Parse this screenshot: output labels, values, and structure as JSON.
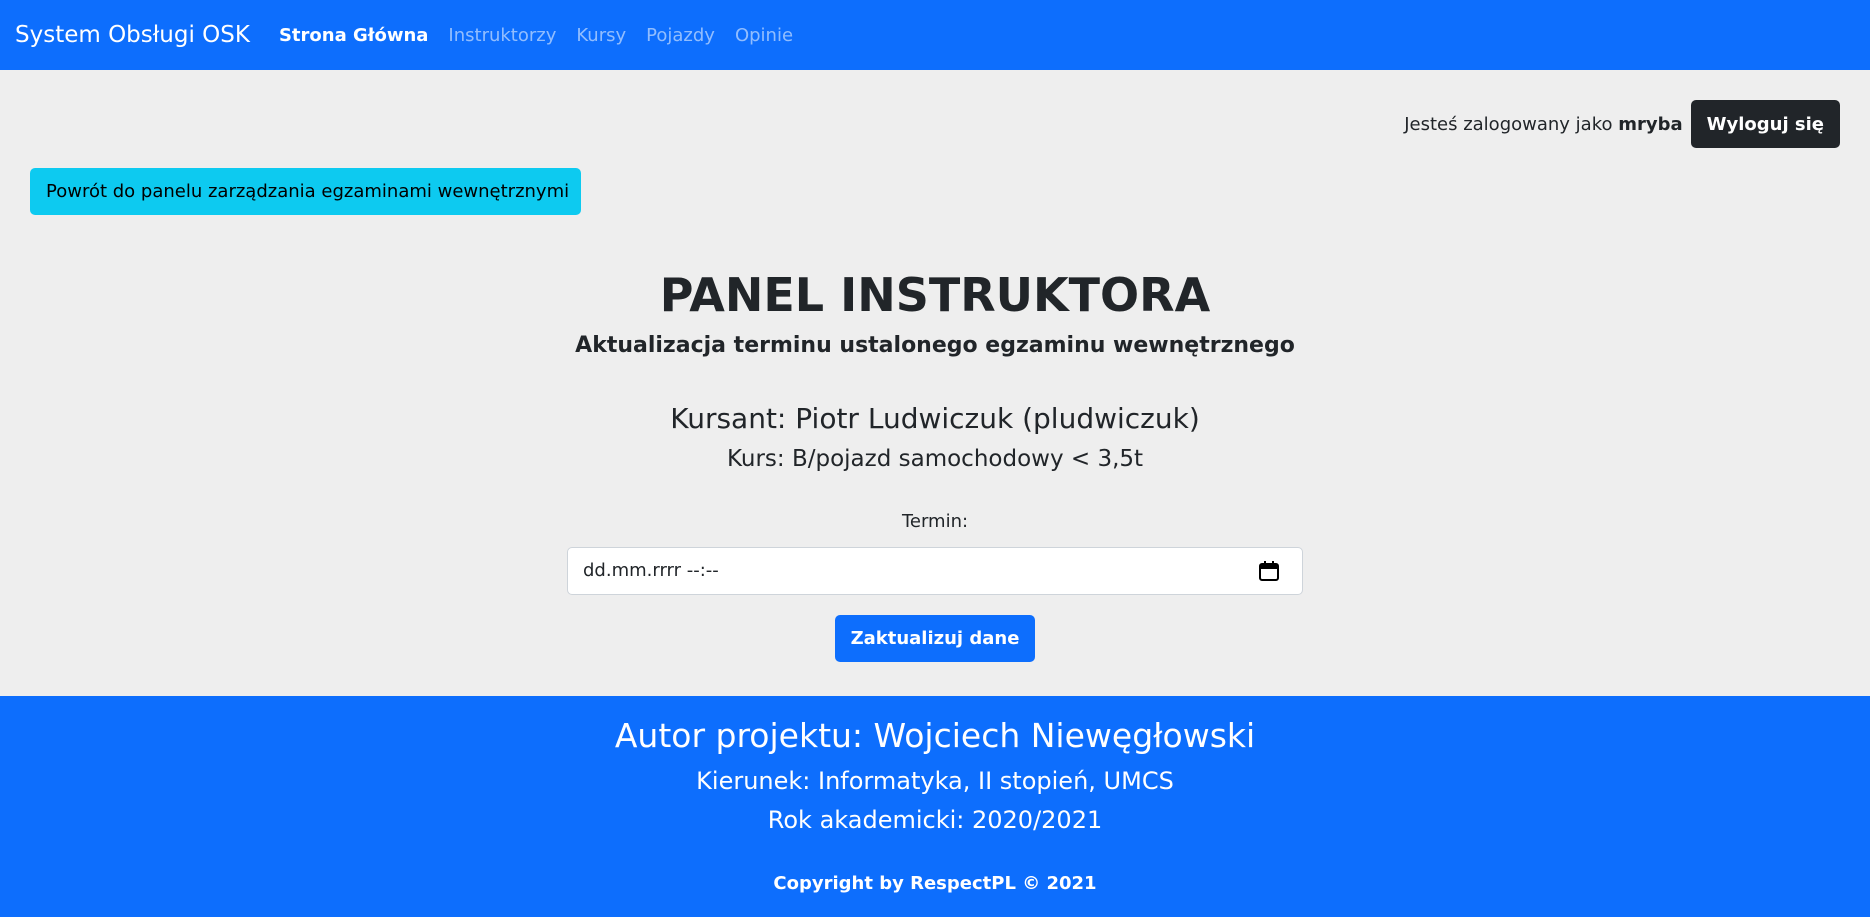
{
  "navbar": {
    "brand": "System Obsługi OSK",
    "links": [
      {
        "label": "Strona Główna",
        "active": true
      },
      {
        "label": "Instruktorzy",
        "active": false
      },
      {
        "label": "Kursy",
        "active": false
      },
      {
        "label": "Pojazdy",
        "active": false
      },
      {
        "label": "Opinie",
        "active": false
      }
    ]
  },
  "user": {
    "logged_in_text": "Jesteś zalogowany jako",
    "username": "mryba",
    "logout_label": "Wyloguj się"
  },
  "back_button": {
    "label": "Powrót do panelu zarządzania egzaminami wewnętrznymi"
  },
  "main": {
    "title": "PANEL INSTRUKTORA",
    "subtitle": "Aktualizacja terminu ustalonego egzaminu wewnętrznego",
    "student": "Kursant: Piotr Ludwiczuk (pludwiczuk)",
    "course": "Kurs: B/pojazd samochodowy < 3,5t",
    "term_label": "Termin:",
    "date_placeholder": "dd.mm.rrrr --:--",
    "submit_label": "Zaktualizuj dane"
  },
  "footer": {
    "author": "Autor projektu: Wojciech Niewęgłowski",
    "field_of_study": "Kierunek: Informatyka, II stopień, UMCS",
    "academic_year": "Rok akademicki: 2020/2021",
    "copyright": "Copyright by RespectPL © 2021"
  },
  "colors": {
    "primary": "#0d6efd",
    "info": "#0dcaf0",
    "dark": "#212529",
    "background": "#eeeeee"
  },
  "icons": {
    "date_picker": "calendar-icon"
  }
}
